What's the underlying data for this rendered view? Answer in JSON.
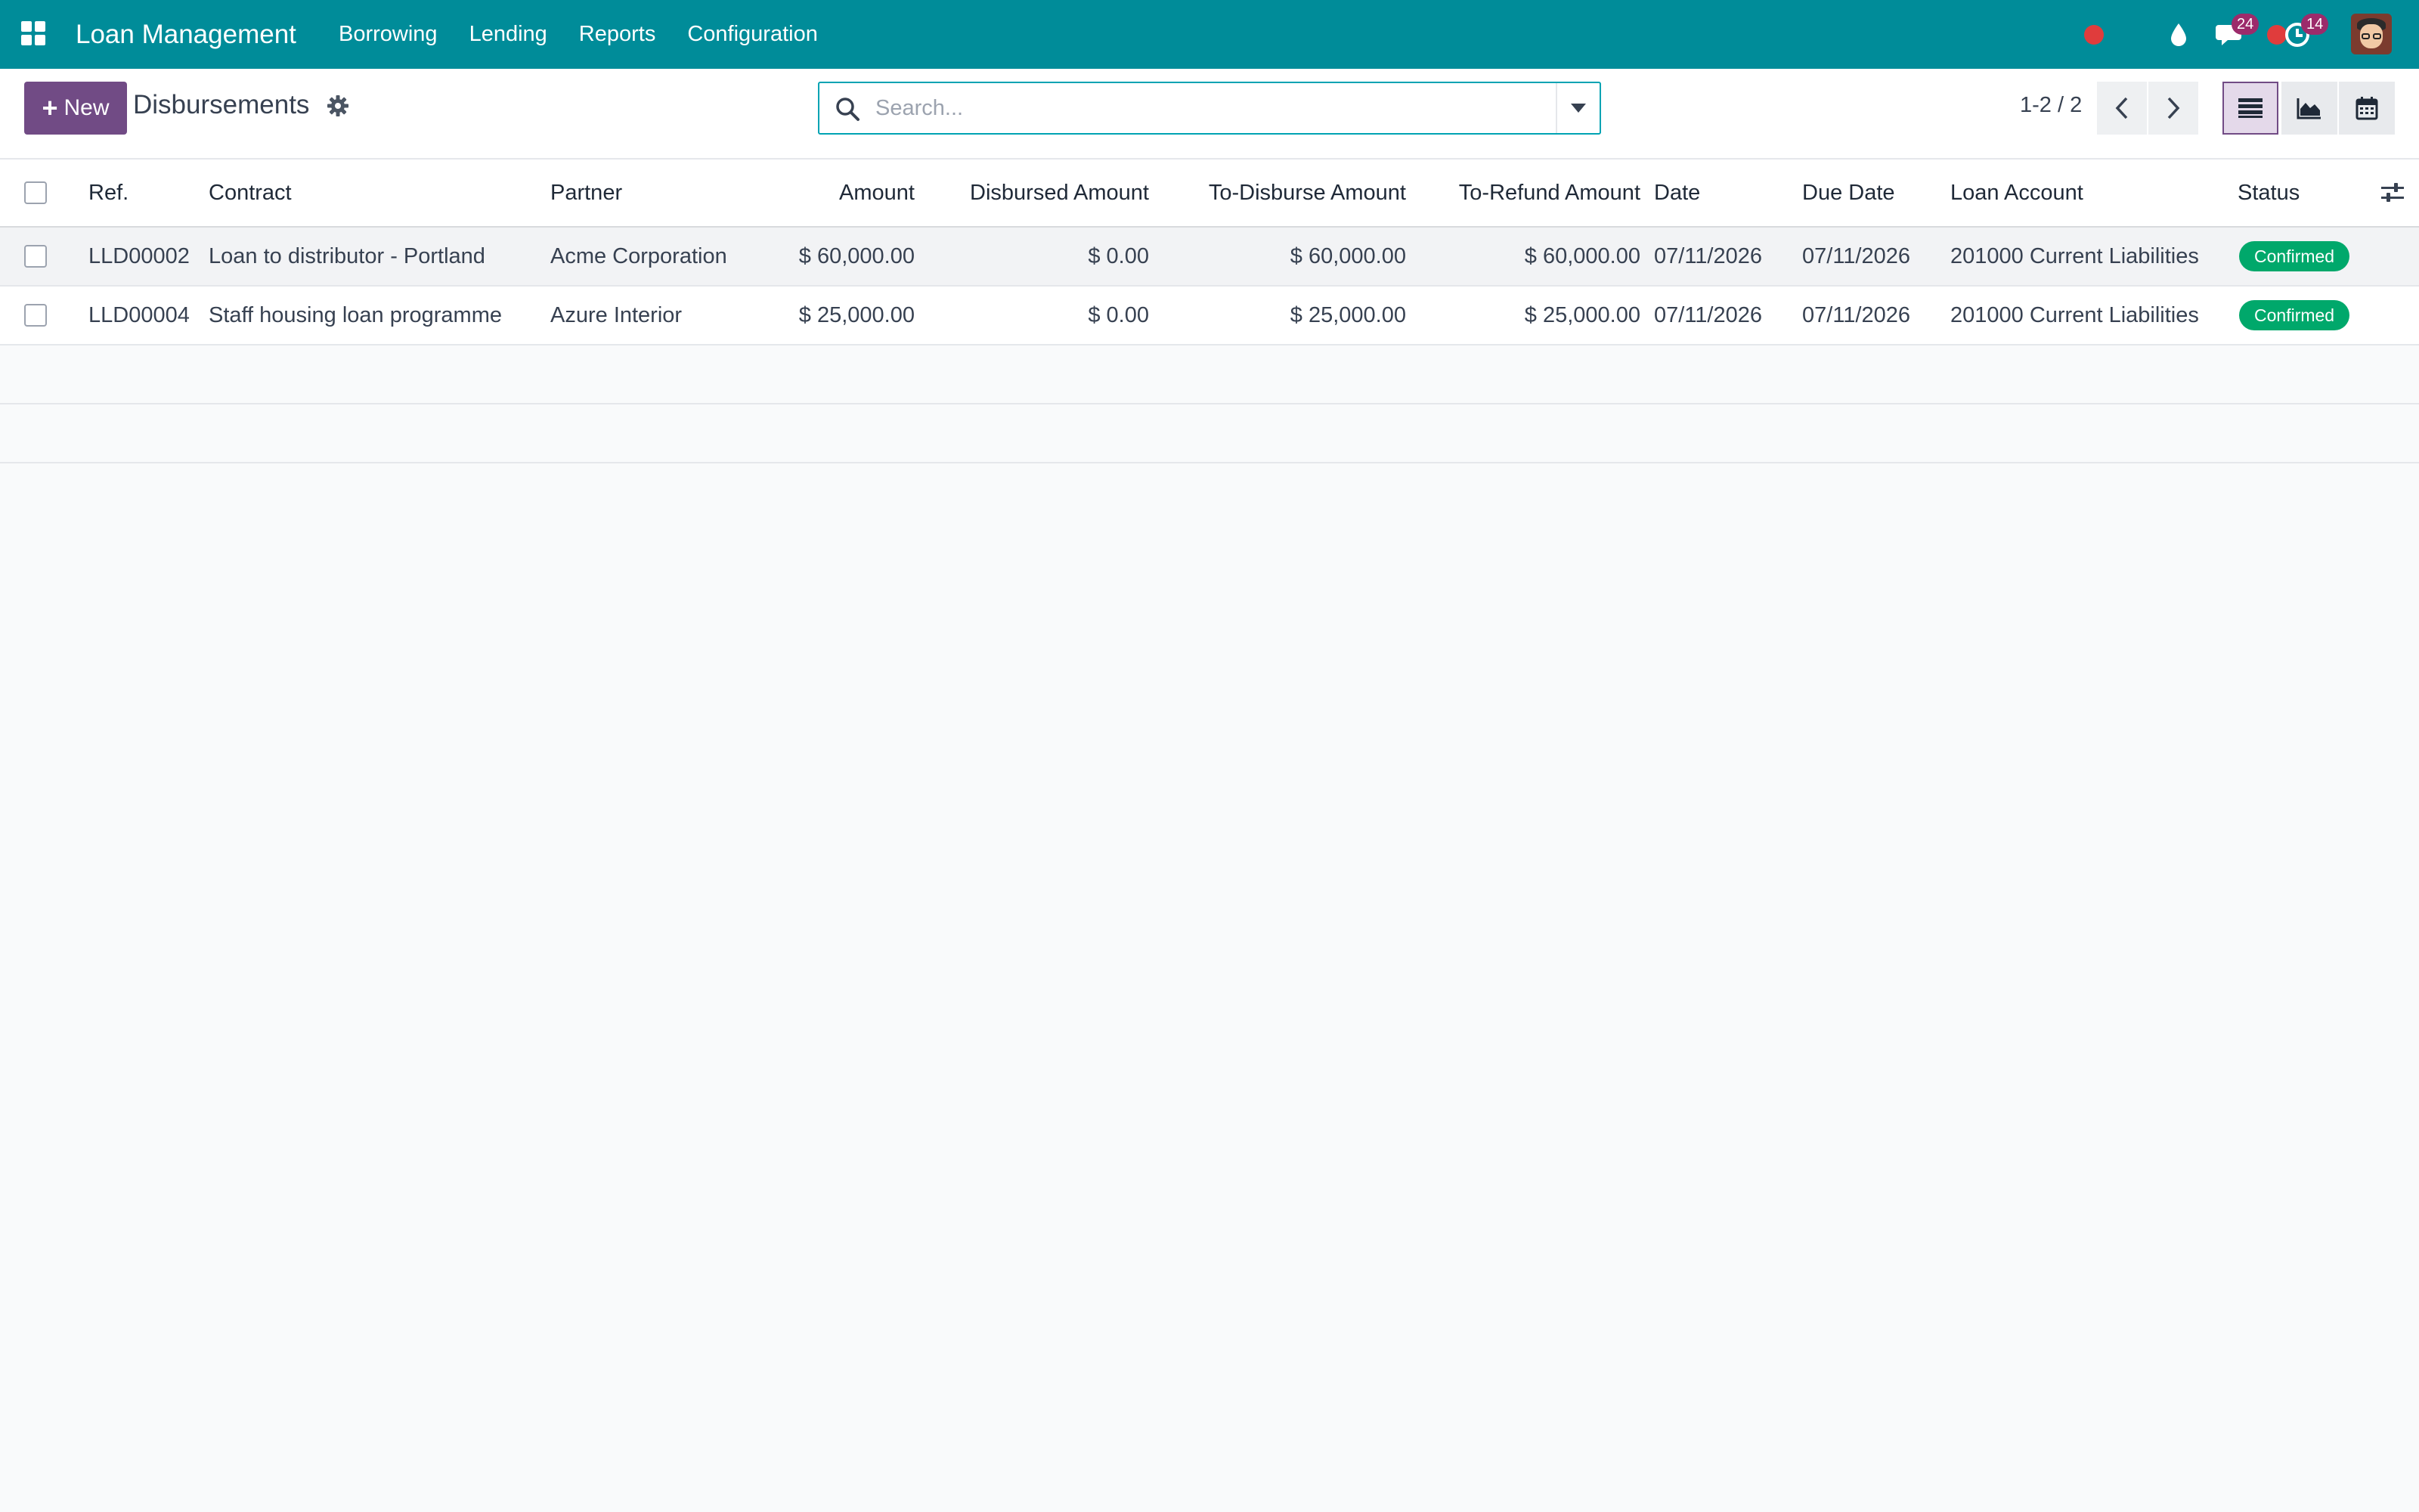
{
  "navbar": {
    "brand": "Loan Management",
    "menu": [
      "Borrowing",
      "Lending",
      "Reports",
      "Configuration"
    ],
    "messages_count": "24",
    "activities_count": "14"
  },
  "control": {
    "new_label": "New",
    "title": "Disbursements",
    "search_placeholder": "Search...",
    "pager": "1-2 / 2"
  },
  "table": {
    "columns": [
      "Ref.",
      "Contract",
      "Partner",
      "Amount",
      "Disbursed Amount",
      "To-Disburse Amount",
      "To-Refund Amount",
      "Date",
      "Due Date",
      "Loan Account",
      "Status"
    ],
    "rows": [
      {
        "ref": "LLD00002",
        "contract": "Loan to distributor - Portland",
        "partner": "Acme Corporation",
        "amount": "$ 60,000.00",
        "disbursed": "$ 0.00",
        "to_disburse": "$ 60,000.00",
        "to_refund": "$ 60,000.00",
        "date": "07/11/2026",
        "due_date": "07/11/2026",
        "loan_account": "201000 Current Liabilities",
        "status": "Confirmed"
      },
      {
        "ref": "LLD00004",
        "contract": "Staff housing loan programme",
        "partner": "Azure Interior",
        "amount": "$ 25,000.00",
        "disbursed": "$ 0.00",
        "to_disburse": "$ 25,000.00",
        "to_refund": "$ 25,000.00",
        "date": "07/11/2026",
        "due_date": "07/11/2026",
        "loan_account": "201000 Current Liabilities",
        "status": "Confirmed"
      }
    ]
  },
  "colors": {
    "navbar": "#008c99",
    "primary": "#714b85",
    "confirmed": "#00a86b",
    "badge": "#9c2b6b"
  }
}
